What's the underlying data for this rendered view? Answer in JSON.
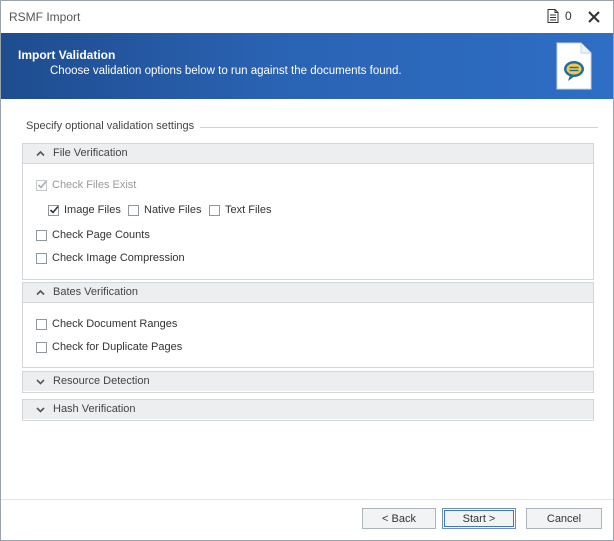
{
  "window": {
    "title": "RSMF Import",
    "doc_count": "0"
  },
  "banner": {
    "title": "Import Validation",
    "subtitle": "Choose validation options below to run against the documents found.",
    "icon": "rsmf-document-icon"
  },
  "settings": {
    "legend": "Specify optional validation settings",
    "file_verification": {
      "label": "File Verification",
      "expanded": true,
      "check_files_exist": {
        "label": "Check Files Exist",
        "checked": true,
        "enabled": false
      },
      "image_files": {
        "label": "Image Files",
        "checked": true
      },
      "native_files": {
        "label": "Native Files",
        "checked": false
      },
      "text_files": {
        "label": "Text Files",
        "checked": false
      },
      "check_page_counts": {
        "label": "Check Page Counts",
        "checked": false
      },
      "check_image_compression": {
        "label": "Check Image Compression",
        "checked": false
      }
    },
    "bates_verification": {
      "label": "Bates Verification",
      "expanded": true,
      "check_document_ranges": {
        "label": "Check Document Ranges",
        "checked": false
      },
      "check_duplicate_pages": {
        "label": "Check for Duplicate Pages",
        "checked": false
      }
    },
    "resource_detection": {
      "label": "Resource Detection",
      "expanded": false
    },
    "hash_verification": {
      "label": "Hash Verification",
      "expanded": false
    }
  },
  "footer": {
    "back_label": "< Back",
    "start_label": "Start >",
    "cancel_label": "Cancel"
  },
  "colors": {
    "banner_start": "#1e4c8f",
    "banner_end": "#2e6ec5",
    "panel_header": "#eceef0"
  }
}
